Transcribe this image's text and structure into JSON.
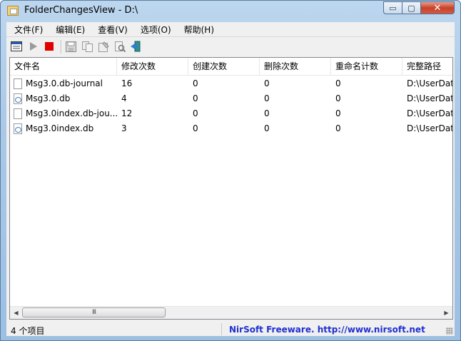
{
  "window": {
    "title": "FolderChangesView  -  D:\\",
    "min_glyph": "▭",
    "max_glyph": "▢",
    "close_glyph": "✕"
  },
  "menu": [
    {
      "label": "文件(F)"
    },
    {
      "label": "编辑(E)"
    },
    {
      "label": "查看(V)"
    },
    {
      "label": "选项(O)"
    },
    {
      "label": "帮助(H)"
    }
  ],
  "toolbar": {
    "icons": [
      "options-icon",
      "start-icon",
      "stop-icon",
      "save-icon",
      "copy-icon",
      "properties-icon",
      "find-icon",
      "exit-icon"
    ]
  },
  "list": {
    "columns": [
      "文件名",
      "修改次数",
      "创建次数",
      "删除次数",
      "重命名计数",
      "完整路径"
    ],
    "rows": [
      {
        "icon": "file-icon",
        "name": "Msg3.0.db-journal",
        "modified": "16",
        "created": "0",
        "deleted": "0",
        "renamed": "0",
        "path": "D:\\UserData"
      },
      {
        "icon": "db-file-icon",
        "name": "Msg3.0.db",
        "modified": "4",
        "created": "0",
        "deleted": "0",
        "renamed": "0",
        "path": "D:\\UserData"
      },
      {
        "icon": "file-icon",
        "name": "Msg3.0index.db-jou...",
        "modified": "12",
        "created": "0",
        "deleted": "0",
        "renamed": "0",
        "path": "D:\\UserData"
      },
      {
        "icon": "db-file-icon",
        "name": "Msg3.0index.db",
        "modified": "3",
        "created": "0",
        "deleted": "0",
        "renamed": "0",
        "path": "D:\\UserData"
      }
    ]
  },
  "scrollbar": {
    "left_arrow": "◀",
    "right_arrow": "▶",
    "thumb_grip": "III"
  },
  "status": {
    "count": "4 个项目",
    "link": "NirSoft Freeware.  http://www.nirsoft.net"
  }
}
